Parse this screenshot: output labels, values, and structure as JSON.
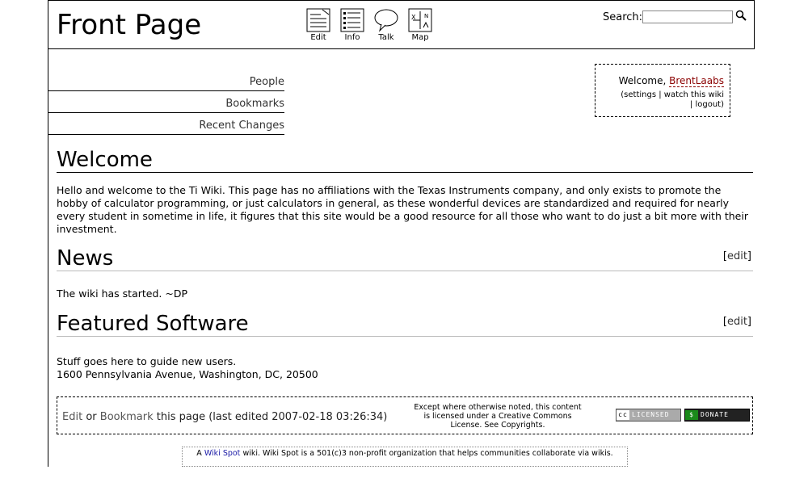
{
  "header": {
    "title": "Front Page",
    "tools": [
      {
        "label": "Edit",
        "icon": "edit-icon"
      },
      {
        "label": "Info",
        "icon": "info-icon"
      },
      {
        "label": "Talk",
        "icon": "talk-icon"
      },
      {
        "label": "Map",
        "icon": "map-icon"
      }
    ],
    "search_label": "Search:",
    "search_value": ""
  },
  "nav": {
    "items": [
      "People",
      "Bookmarks",
      "Recent Changes"
    ]
  },
  "userbox": {
    "welcome": "Welcome,",
    "username": "BrentLaabs",
    "paren_open": "(",
    "settings": "settings",
    "sep1": "|",
    "watch": "watch this wiki",
    "sep2": "|",
    "logout": "logout",
    "paren_close": ")"
  },
  "content": {
    "welcome_heading": "Welcome",
    "welcome_text": "Hello and welcome to the Ti Wiki. This page has no affiliations with the Texas Instruments company, and only exists to promote the hobby of calculator programming, or just calculators in general, as these wonderful devices are standardized and required for nearly every student in sometime in life, it figures that this site would be a good resource for all those who want to do just a bit more with their investment.",
    "news_heading": "News",
    "news_text": "The wiki has started. ~DP",
    "featured_heading": "Featured Software",
    "featured_line1": "Stuff goes here to guide new users.",
    "featured_line2": "1600 Pennsylvania Avenue, Washington, DC, 20500",
    "edit_open": "[",
    "edit_label": "edit",
    "edit_close": "]"
  },
  "footer": {
    "edit": "Edit",
    "or": "or",
    "bookmark": "Bookmark",
    "rest": "this page (last edited 2007-02-18 03:26:34)",
    "license_pre": "Except where otherwise noted, this content is licensed under a",
    "license_link": "Creative Commons License",
    "license_mid": ". See",
    "copyrights": "Copyrights",
    "period": ".",
    "cc_badge": "LICENSED",
    "cc_tag": "cc",
    "donate_badge": "DONATE",
    "donate_tag": "$"
  },
  "spot": {
    "pre": "A",
    "link": "Wiki Spot",
    "post": "wiki. Wiki Spot is a 501(c)3 non-profit organization that helps communities collaborate via wikis."
  },
  "colors": {
    "username": "#8b0000",
    "spot_link": "#1a1aa6"
  }
}
